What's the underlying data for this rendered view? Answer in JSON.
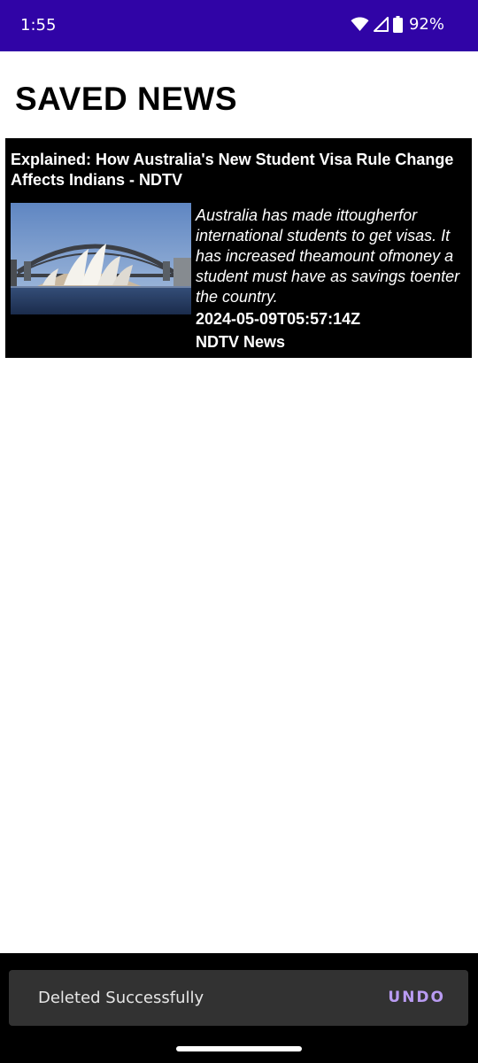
{
  "status_bar": {
    "time": "1:55",
    "battery": "92%",
    "icons": [
      "wifi-icon",
      "cellular-signal-icon",
      "battery-icon"
    ],
    "background": "#3004a6"
  },
  "page": {
    "title": "SAVED NEWS"
  },
  "articles": [
    {
      "title": "Explained: How Australia's New Student Visa Rule Change Affects Indians - NDTV",
      "description": "Australia has made ittougherfor international students to get visas. It has increased theamount ofmoney a student must have as savings toenter the country.",
      "published_at": "2024-05-09T05:57:14Z",
      "source": "NDTV News",
      "thumbnail": "sydney-opera-house-harbour-bridge-photo"
    }
  ],
  "snackbar": {
    "message": "Deleted Successfully",
    "action_label": "UNDO",
    "action_color": "#b99bf2"
  }
}
